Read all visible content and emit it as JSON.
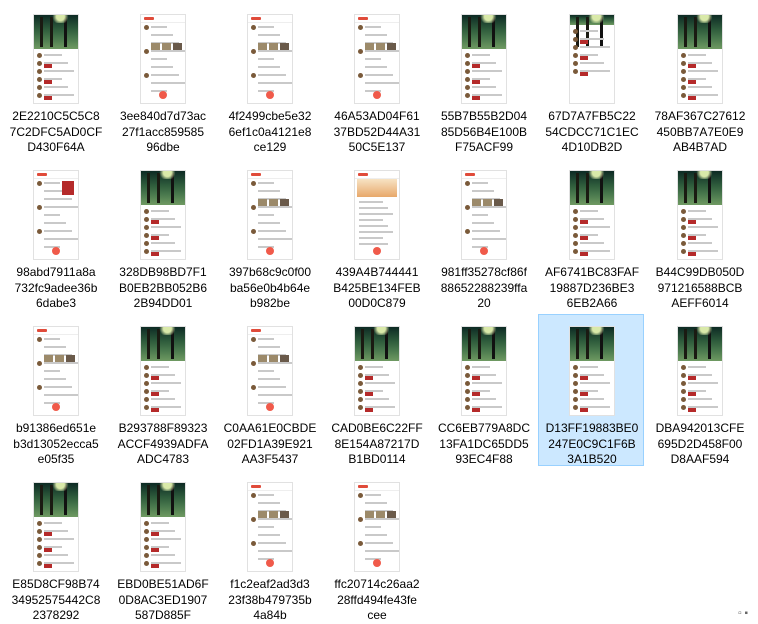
{
  "files": [
    {
      "name": "2E2210C5C5C87C2DFC5AD0CF D430F64A",
      "lines": [
        "2E2210C5C5C8",
        "7C2DFC5AD0CF",
        "D430F64A"
      ],
      "style": "banner",
      "selected": false
    },
    {
      "name": "3ee840d7d73ac27f1acc85958596dbe",
      "lines": [
        "3ee840d7d73ac",
        "27f1acc859585",
        "96dbe"
      ],
      "style": "feed",
      "selected": false
    },
    {
      "name": "4f2499cbe5e326ef1c0a4121e8ce129",
      "lines": [
        "4f2499cbe5e32",
        "6ef1c0a4121e8",
        "ce129"
      ],
      "style": "feed",
      "selected": false
    },
    {
      "name": "46A53AD04F6137BD52D44A3150C5E137",
      "lines": [
        "46A53AD04F61",
        "37BD52D44A31",
        "50C5E137"
      ],
      "style": "feed",
      "selected": false
    },
    {
      "name": "55B7B55B2D0485D56B4E100BF75ACF99",
      "lines": [
        "55B7B55B2D04",
        "85D56B4E100B",
        "F75ACF99"
      ],
      "style": "banner",
      "selected": false
    },
    {
      "name": "67D7A7FB5C2254CDCC71C1EC4D10DB2D",
      "lines": [
        "67D7A7FB5C22",
        "54CDCC71C1EC",
        "4D10DB2D"
      ],
      "style": "banner-small",
      "selected": false
    },
    {
      "name": "78AF367C27612450BB7A7E0E9AB4B7AD",
      "lines": [
        "78AF367C27612",
        "450BB7A7E0E9",
        "AB4B7AD"
      ],
      "style": "banner",
      "selected": false
    },
    {
      "name": "98abd7911a8a732fc9adee36b6dabe3",
      "lines": [
        "98abd7911a8a",
        "732fc9adee36b",
        "6dabe3"
      ],
      "style": "feed-red",
      "selected": false
    },
    {
      "name": "328DB98BD7F1B0EB2BB052B62B94DD01",
      "lines": [
        "328DB98BD7F1",
        "B0EB2BB052B6",
        "2B94DD01"
      ],
      "style": "banner",
      "selected": false
    },
    {
      "name": "397b68c9c0f00ba56e0b4b64eb982be",
      "lines": [
        "397b68c9c0f00",
        "ba56e0b4b64e",
        "b982be"
      ],
      "style": "feed",
      "selected": false
    },
    {
      "name": "439A4B744441B425BE134FEB00D0C879",
      "lines": [
        "439A4B744441",
        "B425BE134FEB",
        "00D0C879"
      ],
      "style": "poster",
      "selected": false
    },
    {
      "name": "981ff35278cf86f88652288239ffa20",
      "lines": [
        "981ff35278cf86f",
        "88652288239ffa",
        "20"
      ],
      "style": "feed",
      "selected": false
    },
    {
      "name": "AF6741BC83FAF19887D236BE36EB2A66",
      "lines": [
        "AF6741BC83FAF",
        "19887D236BE3",
        "6EB2A66"
      ],
      "style": "banner",
      "selected": false
    },
    {
      "name": "B44C99DB050D971216588BCBAEFF6014",
      "lines": [
        "B44C99DB050D",
        "971216588BCB",
        "AEFF6014"
      ],
      "style": "banner",
      "selected": false
    },
    {
      "name": "b91386ed651eb3d13052ecca5e05f35",
      "lines": [
        "b91386ed651e",
        "b3d13052ecca5",
        "e05f35"
      ],
      "style": "feed",
      "selected": false
    },
    {
      "name": "B293788F89323ACCF4939ADFAADC4783",
      "lines": [
        "B293788F89323",
        "ACCF4939ADFA",
        "ADC4783"
      ],
      "style": "banner",
      "selected": false
    },
    {
      "name": "C0AA61E0CBDE02FD1A39E921AA3F5437",
      "lines": [
        "C0AA61E0CBDE",
        "02FD1A39E921",
        "AA3F5437"
      ],
      "style": "feed-pics",
      "selected": false
    },
    {
      "name": "CAD0BE6C22FF8E154A87217DB1BD0114",
      "lines": [
        "CAD0BE6C22FF",
        "8E154A87217D",
        "B1BD0114"
      ],
      "style": "banner",
      "selected": false
    },
    {
      "name": "CC6EB779A8DC13FA1DC65DD593EC4F88",
      "lines": [
        "CC6EB779A8DC",
        "13FA1DC65DD5",
        "93EC4F88"
      ],
      "style": "banner",
      "selected": false
    },
    {
      "name": "D13FF19883BE0247E0C9C1F6B3A1B520",
      "lines": [
        "D13FF19883BE0",
        "247E0C9C1F6B",
        "3A1B520"
      ],
      "style": "banner",
      "selected": true
    },
    {
      "name": "DBA942013CFE695D2D458F00D8AAF594",
      "lines": [
        "DBA942013CFE",
        "695D2D458F00",
        "D8AAF594"
      ],
      "style": "banner",
      "selected": false
    },
    {
      "name": "E85D8CF98B7434952575442C82378292",
      "lines": [
        "E85D8CF98B74",
        "34952575442C8",
        "2378292"
      ],
      "style": "banner",
      "selected": false
    },
    {
      "name": "EBD0BE51AD6F0D8AC3ED1907587D885F",
      "lines": [
        "EBD0BE51AD6F",
        "0D8AC3ED1907",
        "587D885F"
      ],
      "style": "banner",
      "selected": false
    },
    {
      "name": "f1c2eaf2ad3d323f38b479735b4a84b",
      "lines": [
        "f1c2eaf2ad3d3",
        "23f38b479735b",
        "4a84b"
      ],
      "style": "feed-pics",
      "selected": false
    },
    {
      "name": "ffc20714c26aa228ffd494fe43fecee",
      "lines": [
        "ffc20714c26aa2",
        "28ffd494fe43fe",
        "cee"
      ],
      "style": "feed",
      "selected": false
    }
  ],
  "statusbar": {
    "text": "▫︎ ▪︎"
  }
}
